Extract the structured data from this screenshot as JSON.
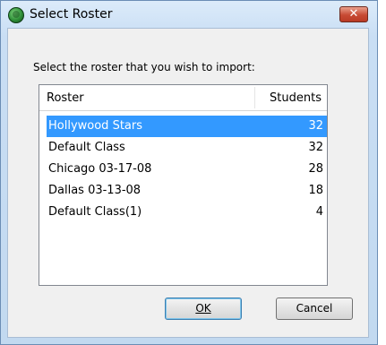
{
  "window": {
    "title": "Select Roster",
    "close_label": "✕"
  },
  "prompt": "Select the roster that you wish to import:",
  "list": {
    "columns": [
      "Roster",
      "Students"
    ],
    "rows": [
      {
        "name": "Hollywood Stars",
        "students": "32",
        "selected": true
      },
      {
        "name": "Default Class",
        "students": "32",
        "selected": false
      },
      {
        "name": "Chicago 03-17-08",
        "students": "28",
        "selected": false
      },
      {
        "name": "Dallas 03-13-08",
        "students": "18",
        "selected": false
      },
      {
        "name": "Default Class(1)",
        "students": "4",
        "selected": false
      }
    ]
  },
  "buttons": {
    "ok_label": "OK",
    "cancel_label": "Cancel"
  },
  "colors": {
    "selection": "#3399ff",
    "close_button": "#c74a34"
  }
}
